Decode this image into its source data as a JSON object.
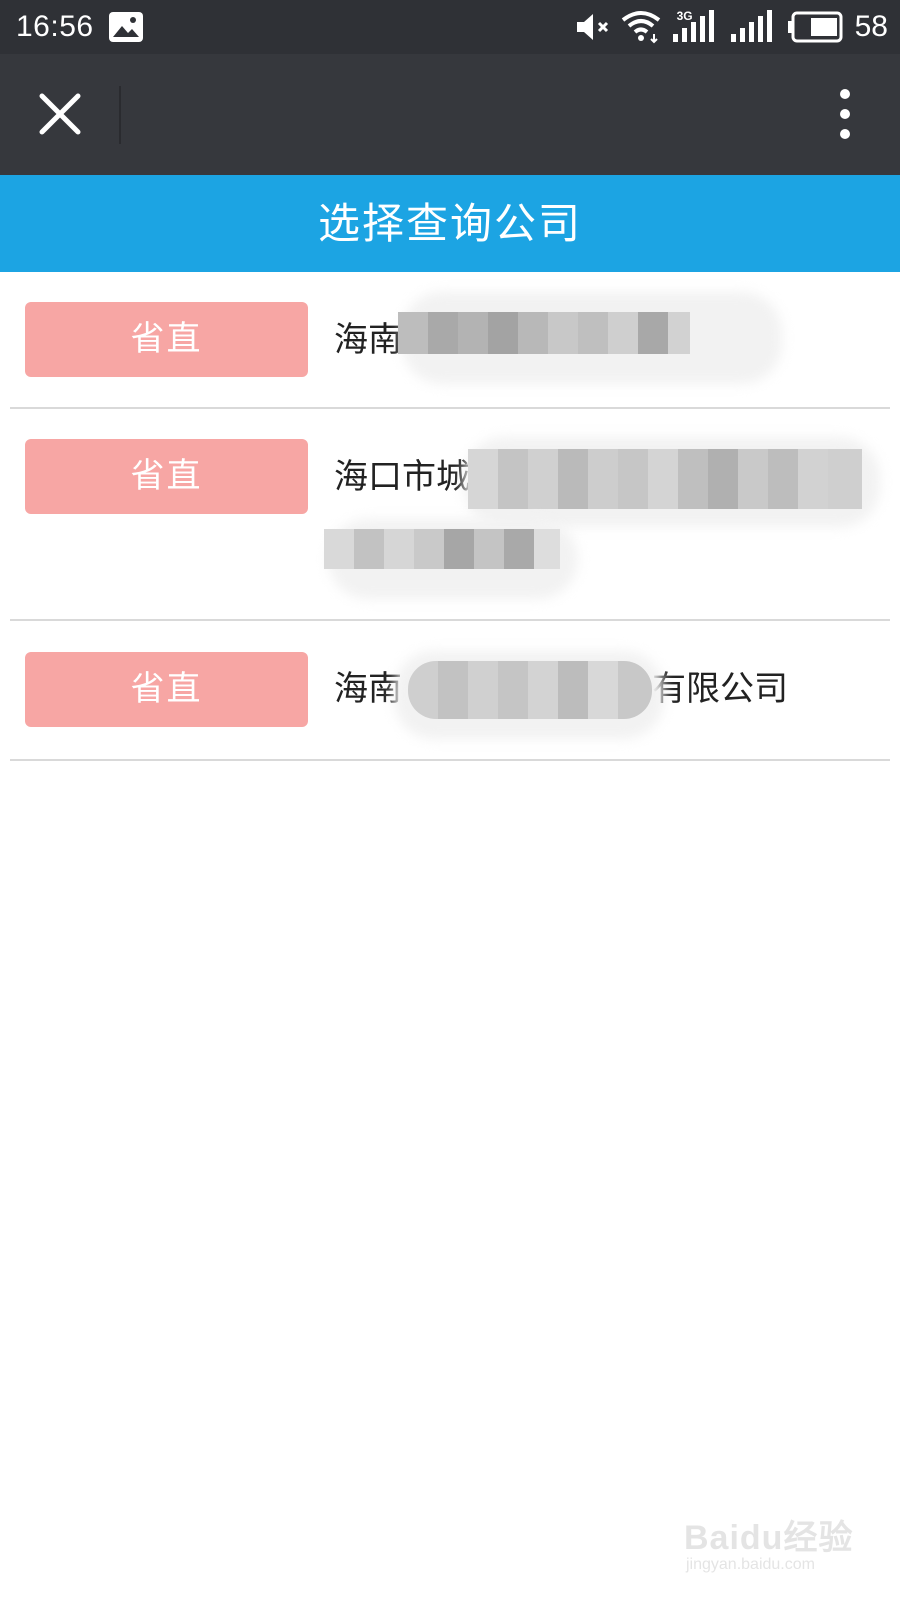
{
  "status_bar": {
    "time": "16:56",
    "battery_percent": "58",
    "network_type": "3G",
    "icons": [
      "gallery-icon",
      "mute-icon",
      "wifi-icon",
      "signal-3g-icon",
      "signal-icon",
      "battery-icon"
    ]
  },
  "toolbar": {
    "close_icon": "close-icon",
    "more_icon": "more-vertical-icon"
  },
  "header": {
    "title": "选择查询公司",
    "background": "#1ca4e3"
  },
  "companies": [
    {
      "tag": "省直",
      "name": "海南"
    },
    {
      "tag": "省直",
      "name": "海口市城"
    },
    {
      "tag": "省直",
      "name_prefix": "海南",
      "name_suffix": "有限公司"
    }
  ],
  "colors": {
    "status_bar": "#2f3136",
    "toolbar": "#36383d",
    "tag_background": "#f7a6a4"
  },
  "watermark": {
    "main": "Baidu经验",
    "sub": "jingyan.baidu.com"
  }
}
